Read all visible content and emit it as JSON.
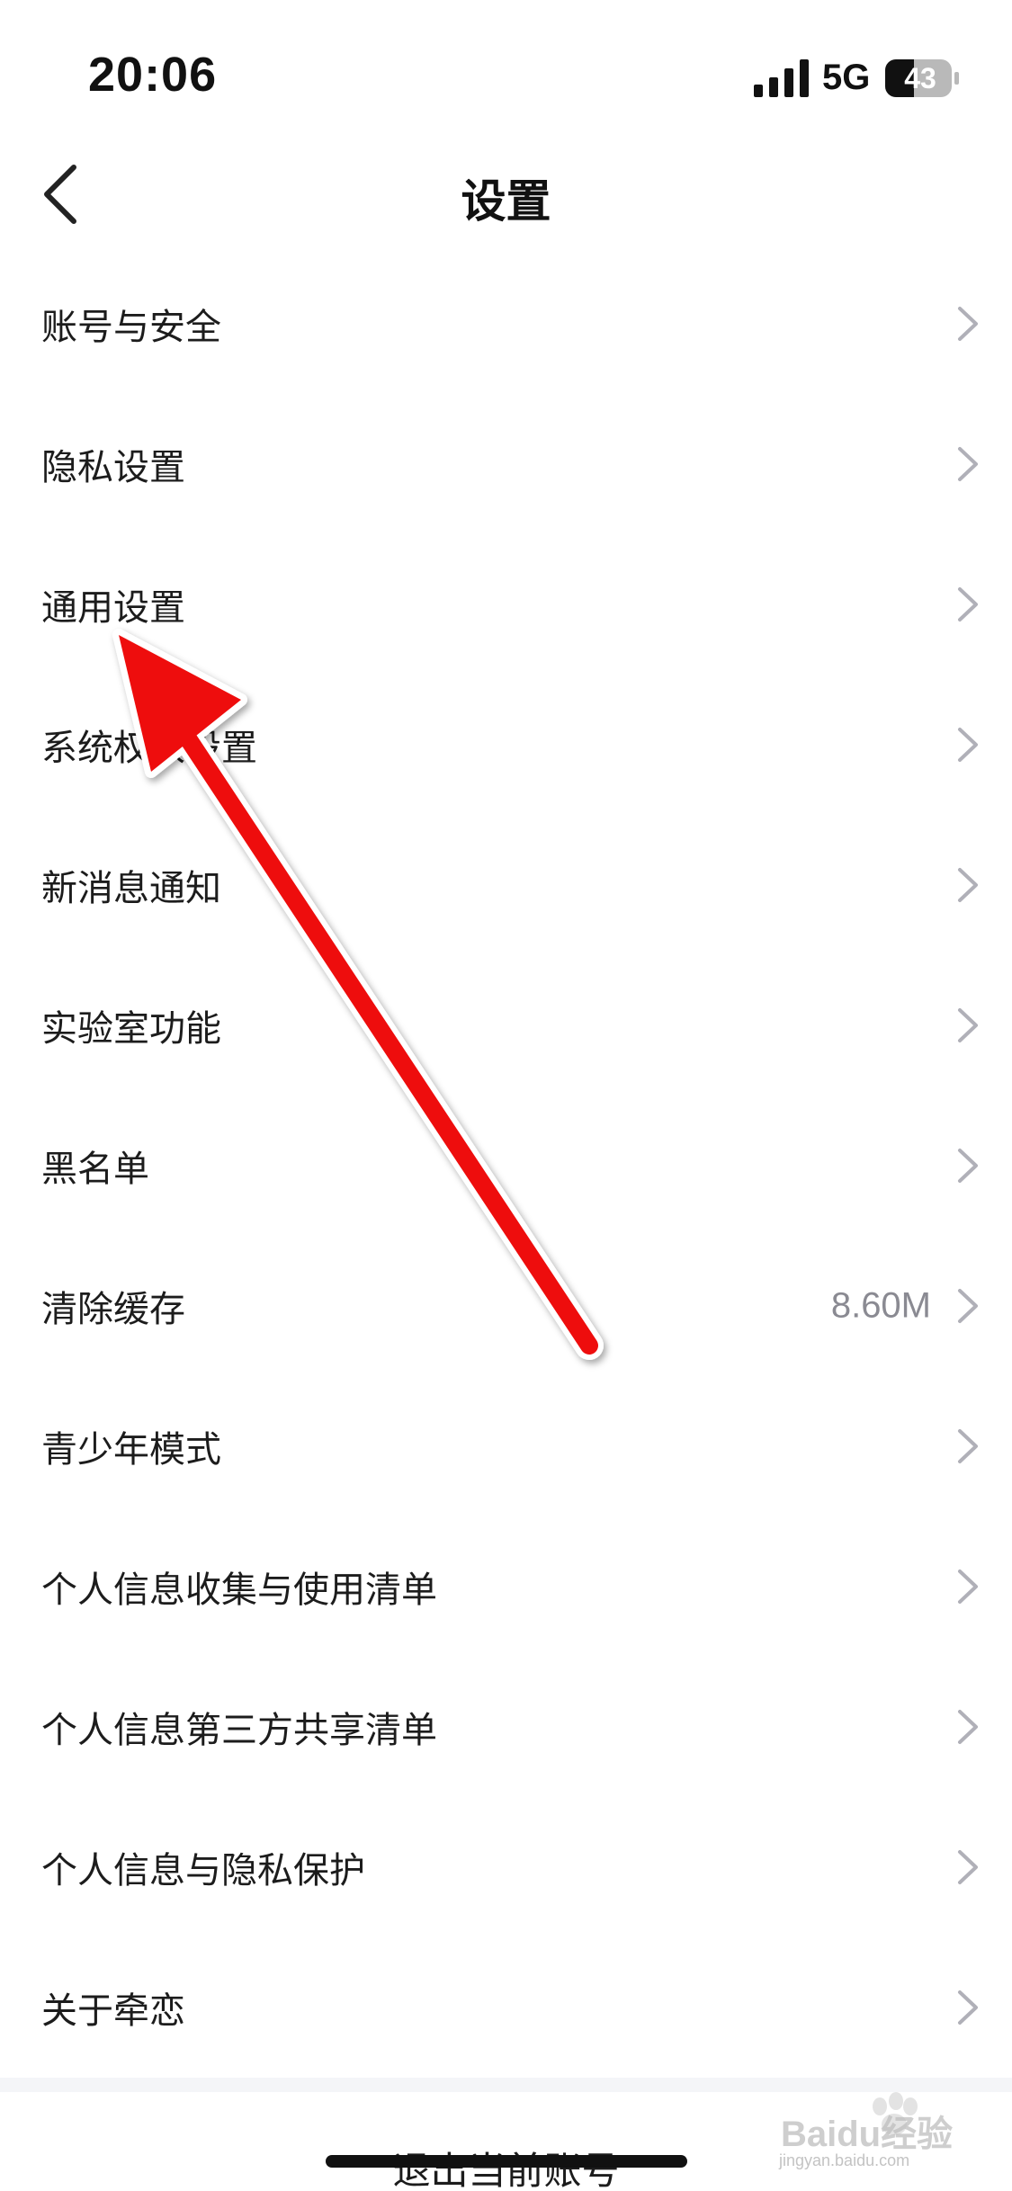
{
  "status_bar": {
    "time": "20:06",
    "network": "5G",
    "battery": "43",
    "signal_icon": "cellular-signal-icon",
    "battery_icon": "battery-icon"
  },
  "nav": {
    "back_icon": "chevron-left-icon",
    "title": "设置"
  },
  "settings": {
    "items": [
      {
        "label": "账号与安全",
        "value": ""
      },
      {
        "label": "隐私设置",
        "value": ""
      },
      {
        "label": "通用设置",
        "value": ""
      },
      {
        "label": "系统权限设置",
        "value": ""
      },
      {
        "label": "新消息通知",
        "value": ""
      },
      {
        "label": "实验室功能",
        "value": ""
      },
      {
        "label": "黑名单",
        "value": ""
      },
      {
        "label": "清除缓存",
        "value": "8.60M"
      },
      {
        "label": "青少年模式",
        "value": ""
      },
      {
        "label": "个人信息收集与使用清单",
        "value": ""
      },
      {
        "label": "个人信息第三方共享清单",
        "value": ""
      },
      {
        "label": "个人信息与隐私保护",
        "value": ""
      },
      {
        "label": "关于牵恋",
        "value": ""
      }
    ],
    "chevron_icon": "chevron-right-icon"
  },
  "logout": {
    "label": "退出当前账号"
  },
  "annotation": {
    "type": "red-arrow",
    "color": "#ee1111",
    "points_to": "通用设置"
  },
  "watermark": {
    "text": "Baidu经验",
    "sub": "jingyan.baidu.com"
  },
  "colors": {
    "background": "#ffffff",
    "text": "#1c1c1c",
    "secondary_text": "#8a8a92",
    "chevron": "#b0b0b8"
  }
}
